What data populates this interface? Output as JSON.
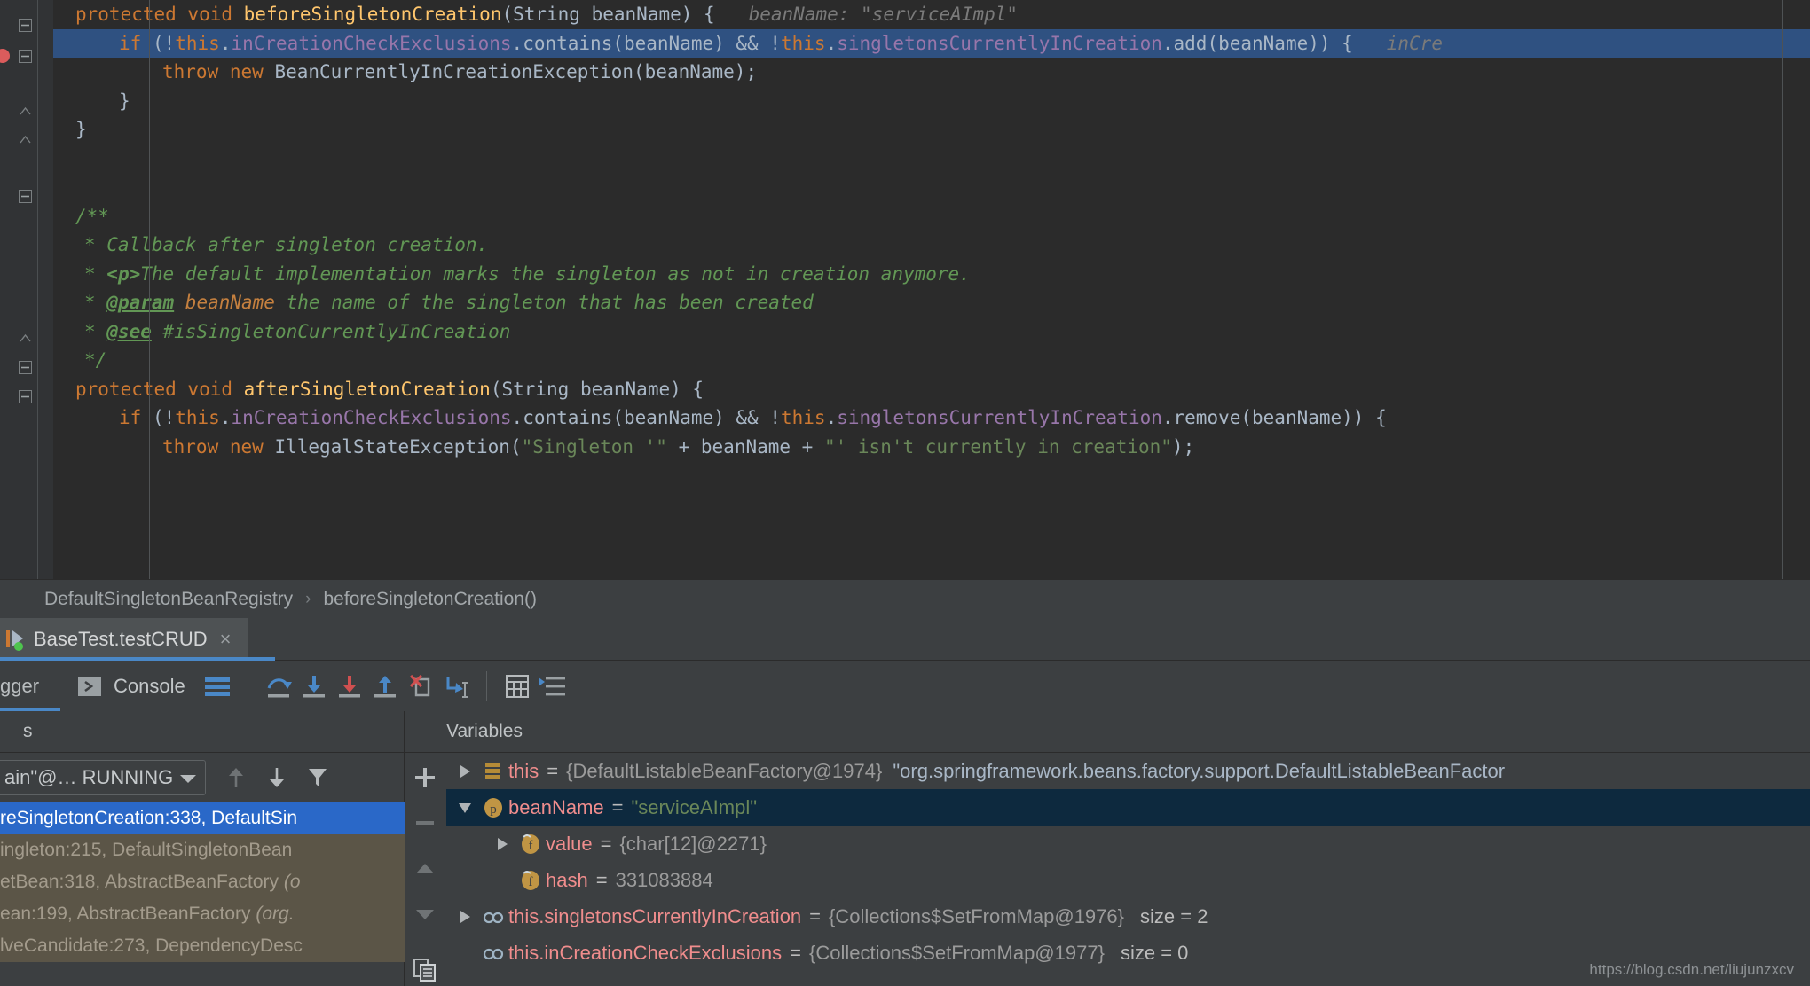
{
  "editor": {
    "lines": [
      {
        "indent": 0,
        "tokens": [
          {
            "t": "kw",
            "s": "protected void "
          },
          {
            "t": "fn",
            "s": "beforeSingletonCreation"
          },
          {
            "t": "plain",
            "s": "(String beanName) {"
          },
          {
            "t": "hint",
            "s": "   beanName: \"serviceAImpl\""
          }
        ]
      },
      {
        "indent": 1,
        "highlight": true,
        "tokens": [
          {
            "t": "kw",
            "s": "if "
          },
          {
            "t": "plain",
            "s": "(!"
          },
          {
            "t": "kw",
            "s": "this"
          },
          {
            "t": "plain",
            "s": "."
          },
          {
            "t": "fld",
            "s": "inCreationCheckExclusions"
          },
          {
            "t": "plain",
            "s": ".contains(beanName) && !"
          },
          {
            "t": "kw",
            "s": "this"
          },
          {
            "t": "plain",
            "s": "."
          },
          {
            "t": "fld",
            "s": "singletonsCurrentlyInCreation"
          },
          {
            "t": "plain",
            "s": ".add(beanName)) {"
          },
          {
            "t": "hint",
            "s": "   inCre"
          }
        ]
      },
      {
        "indent": 2,
        "tokens": [
          {
            "t": "kw",
            "s": "throw new "
          },
          {
            "t": "plain",
            "s": "BeanCurrentlyInCreationException(beanName);"
          }
        ]
      },
      {
        "indent": 1,
        "tokens": [
          {
            "t": "plain",
            "s": "}"
          }
        ]
      },
      {
        "indent": 0,
        "tokens": [
          {
            "t": "plain",
            "s": "}"
          }
        ]
      },
      {
        "indent": 0,
        "tokens": []
      },
      {
        "indent": 0,
        "tokens": []
      },
      {
        "indent": 0,
        "tokens": [
          {
            "t": "cmt",
            "s": "/**"
          }
        ]
      },
      {
        "indent": 0,
        "pad": 8,
        "tokens": [
          {
            "t": "cmt",
            "s": "* Callback after singleton creation."
          }
        ]
      },
      {
        "indent": 0,
        "pad": 8,
        "tokens": [
          {
            "t": "cmt",
            "s": "* "
          },
          {
            "t": "cmthtml",
            "s": "<p>"
          },
          {
            "t": "cmt",
            "s": "The default implementation marks the singleton as not in creation anymore."
          }
        ]
      },
      {
        "indent": 0,
        "pad": 8,
        "tokens": [
          {
            "t": "cmt",
            "s": "* "
          },
          {
            "t": "cmttag",
            "s": "@param"
          },
          {
            "t": "cmtparam",
            "s": " beanName"
          },
          {
            "t": "cmt",
            "s": " the name of the singleton that has been created"
          }
        ]
      },
      {
        "indent": 0,
        "pad": 8,
        "tokens": [
          {
            "t": "cmt",
            "s": "* "
          },
          {
            "t": "cmttag",
            "s": "@see"
          },
          {
            "t": "cmt",
            "s": " #isSingletonCurrentlyInCreation"
          }
        ]
      },
      {
        "indent": 0,
        "pad": 8,
        "tokens": [
          {
            "t": "cmt",
            "s": "*/"
          }
        ]
      },
      {
        "indent": 0,
        "tokens": [
          {
            "t": "kw",
            "s": "protected void "
          },
          {
            "t": "fn",
            "s": "afterSingletonCreation"
          },
          {
            "t": "plain",
            "s": "(String beanName) {"
          }
        ]
      },
      {
        "indent": 1,
        "tokens": [
          {
            "t": "kw",
            "s": "if "
          },
          {
            "t": "plain",
            "s": "(!"
          },
          {
            "t": "kw",
            "s": "this"
          },
          {
            "t": "plain",
            "s": "."
          },
          {
            "t": "fld",
            "s": "inCreationCheckExclusions"
          },
          {
            "t": "plain",
            "s": ".contains(beanName) && !"
          },
          {
            "t": "kw",
            "s": "this"
          },
          {
            "t": "plain",
            "s": "."
          },
          {
            "t": "fld",
            "s": "singletonsCurrentlyInCreation"
          },
          {
            "t": "plain",
            "s": ".remove(beanName)) {"
          }
        ]
      },
      {
        "indent": 2,
        "tokens": [
          {
            "t": "kw",
            "s": "throw new "
          },
          {
            "t": "plain",
            "s": "IllegalStateException("
          },
          {
            "t": "str",
            "s": "\"Singleton '\""
          },
          {
            "t": "plain",
            "s": " + beanName + "
          },
          {
            "t": "str",
            "s": "\"' isn't currently in creation\""
          },
          {
            "t": "plain",
            "s": ");"
          }
        ]
      }
    ]
  },
  "breadcrumb": {
    "class_name": "DefaultSingletonBeanRegistry",
    "separator": "›",
    "method_name": "beforeSingletonCreation()"
  },
  "run_tab": {
    "label": "BaseTest.testCRUD",
    "close": "×"
  },
  "debug_toolbar": {
    "left_tab_label": "gger",
    "console_label": "Console",
    "buttons": [
      {
        "name": "layout-settings-icon",
        "title": "Layout Settings"
      },
      {
        "name": "step-over-icon",
        "title": "Step Over"
      },
      {
        "name": "step-into-icon",
        "title": "Step Into"
      },
      {
        "name": "force-step-into-icon",
        "title": "Force Step Into"
      },
      {
        "name": "step-out-icon",
        "title": "Step Out"
      },
      {
        "name": "drop-frame-icon",
        "title": "Drop Frame"
      },
      {
        "name": "run-to-cursor-icon",
        "title": "Run to Cursor"
      },
      {
        "name": "evaluate-expression-icon",
        "title": "Evaluate Expression"
      },
      {
        "name": "show-execution-point-icon",
        "title": "Show Execution Point"
      }
    ]
  },
  "frames": {
    "header": "s",
    "thread_label": "ain\"@… RUNNING",
    "rows": [
      {
        "text": "reSingletonCreation:338, DefaultSin",
        "state": "selected"
      },
      {
        "text": "ingleton:215, DefaultSingletonBean",
        "state": "library"
      },
      {
        "text": "etBean:318, AbstractBeanFactory ",
        "pkg": "(o",
        "state": "library"
      },
      {
        "text": "ean:199, AbstractBeanFactory ",
        "pkg": "(org.",
        "state": "library"
      },
      {
        "text": "lveCandidate:273, DependencyDesc",
        "state": "library"
      }
    ],
    "toolbar_icons": [
      "arrow-up-icon",
      "arrow-down-icon",
      "filter-icon"
    ]
  },
  "variables": {
    "header": "Variables",
    "toolstrip_icons": [
      "plus-icon",
      "minus-icon",
      "up-icon",
      "down-icon",
      "copy-icon"
    ],
    "rows": [
      {
        "indent": 0,
        "arrow": "collapsed",
        "icon": "object-icon",
        "name": "this",
        "eq": "=",
        "ref": "{DefaultListableBeanFactory@1974}",
        "value": "\"org.springframework.beans.factory.support.DefaultListableBeanFactor",
        "value_kind": "plain",
        "selected": false
      },
      {
        "indent": 0,
        "arrow": "expanded",
        "icon": "param-icon",
        "name": "beanName",
        "eq": "=",
        "ref": "",
        "value": "\"serviceAImpl\"",
        "value_kind": "string",
        "selected": true
      },
      {
        "indent": 1,
        "arrow": "collapsed",
        "icon": "field-icon",
        "name": "value",
        "eq": "=",
        "ref": "{char[12]@2271}",
        "value": "",
        "value_kind": "plain",
        "selected": false
      },
      {
        "indent": 1,
        "arrow": "none",
        "icon": "field-icon",
        "name": "hash",
        "eq": "=",
        "ref": "331083884",
        "value": "",
        "value_kind": "plain",
        "selected": false
      },
      {
        "indent": 0,
        "arrow": "collapsed",
        "icon": "watch-icon",
        "name": "this.singletonsCurrentlyInCreation",
        "eq": "=",
        "ref": "{Collections$SetFromMap@1976}",
        "size": "size = 2",
        "value": "",
        "value_kind": "plain",
        "selected": false
      },
      {
        "indent": 0,
        "arrow": "none",
        "icon": "watch-icon",
        "name": "this.inCreationCheckExclusions",
        "eq": "=",
        "ref": "{Collections$SetFromMap@1977}",
        "size": "size = 0",
        "value": "",
        "value_kind": "plain",
        "selected": false
      }
    ]
  },
  "watermark": "https://blog.csdn.net/liujunzxcv",
  "colors": {
    "editor_bg": "#2b2b2b",
    "highlight_line": "#2f5181",
    "panel_bg": "#3c3f41",
    "accent_blue": "#4a88c7",
    "selection_blue": "#2a68c8",
    "library_frame": "#5b5547",
    "keyword_orange": "#cc7832",
    "method_yellow": "#ffc66d",
    "field_purple": "#9876aa",
    "string_green": "#6a8759",
    "comment_green": "#629755",
    "var_name_red": "#f08d8d"
  }
}
